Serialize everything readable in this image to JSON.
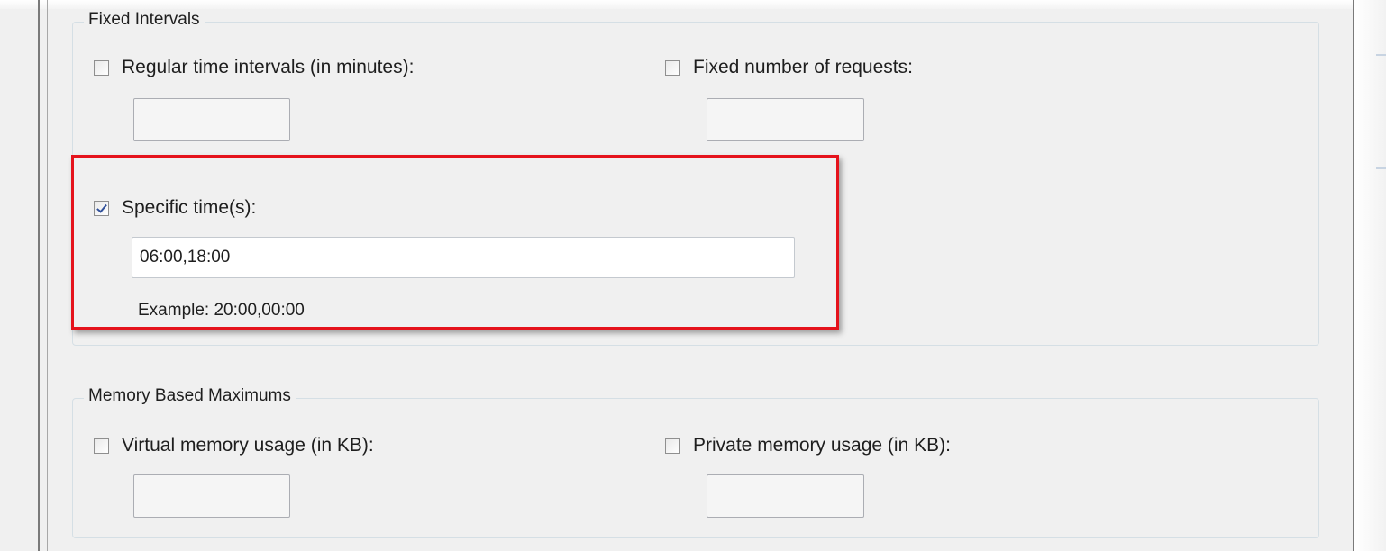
{
  "fixed_intervals": {
    "legend": "Fixed Intervals",
    "regular_time": {
      "label": "Regular time intervals (in minutes):",
      "checked": false,
      "value": ""
    },
    "fixed_requests": {
      "label": "Fixed number of requests:",
      "checked": false,
      "value": ""
    },
    "specific_times": {
      "label": "Specific time(s):",
      "checked": true,
      "value": "06:00,18:00",
      "example": "Example: 20:00,00:00"
    }
  },
  "memory_maximums": {
    "legend": "Memory Based Maximums",
    "virtual_memory": {
      "label": "Virtual memory usage (in KB):",
      "checked": false,
      "value": ""
    },
    "private_memory": {
      "label": "Private memory usage (in KB):",
      "checked": false,
      "value": ""
    }
  },
  "colors": {
    "highlight": "#e5131c",
    "check_mark": "#30509a"
  }
}
